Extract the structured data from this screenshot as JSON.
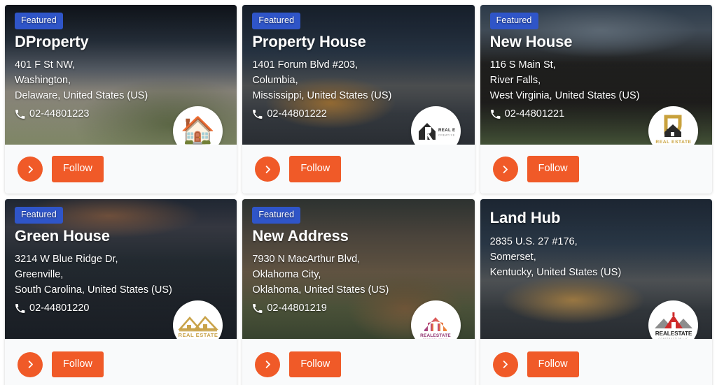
{
  "page": {
    "layout": "grid-3-columns",
    "accent_color": "#f05a28",
    "badge_color": "#2f55c8",
    "footer_background": "#f9fafb",
    "card_background": "#ffffff"
  },
  "labels": {
    "featured": "Featured",
    "follow": "Follow",
    "go_icon": "chevron-right-icon",
    "phone_icon": "phone-icon"
  },
  "cards": [
    {
      "id": "dproperty",
      "featured": true,
      "badge": "Featured",
      "title": "DProperty",
      "address_line1": "401 F St NW,",
      "address_line2": "Washington,",
      "address_line3": "Delaware, United States (US)",
      "phone": "02-44801223",
      "follow_label": "Follow",
      "avatar_icon": "house-logo-icon",
      "avatar_style": "cartoon-house-red-roof",
      "photo_class": "ph-1"
    },
    {
      "id": "property-house",
      "featured": true,
      "badge": "Featured",
      "title": "Property House",
      "address_line1": "1401 Forum Blvd #203,",
      "address_line2": "Columbia,",
      "address_line3": "Mississippi, United States (US)",
      "phone": "02-44801222",
      "follow_label": "Follow",
      "avatar_icon": "real-estate-creative-design-logo-icon",
      "avatar_style": "black-r-house-real-estate-creative-design",
      "photo_class": "ph-2"
    },
    {
      "id": "new-house",
      "featured": true,
      "badge": "Featured",
      "title": "New House",
      "address_line1": "116 S Main St,",
      "address_line2": "River Falls,",
      "address_line3": "West Virginia, United States (US)",
      "phone": "02-44801221",
      "follow_label": "Follow",
      "avatar_icon": "real-estate-tagline-logo-icon",
      "avatar_style": "gold-r-real-estate-tagline",
      "photo_class": "ph-3"
    },
    {
      "id": "green-house",
      "featured": true,
      "badge": "Featured",
      "title": "Green House",
      "address_line1": "3214 W Blue Ridge Dr,",
      "address_line2": "Greenville,",
      "address_line3": "South Carolina, United States (US)",
      "phone": "02-44801220",
      "follow_label": "Follow",
      "avatar_icon": "real-estate-slogan-logo-icon",
      "avatar_style": "gold-rooftops-real-estate-slogan",
      "photo_class": "ph-4"
    },
    {
      "id": "new-address",
      "featured": true,
      "badge": "Featured",
      "title": "New Address",
      "address_line1": "7930 N MacArthur Blvd,",
      "address_line2": "Oklahoma City,",
      "address_line3": "Oklahoma, United States (US)",
      "phone": "02-44801219",
      "follow_label": "Follow",
      "avatar_icon": "realestate-gradient-house-logo-icon",
      "avatar_style": "pink-orange-gradient-house-realestate",
      "photo_class": "ph-5"
    },
    {
      "id": "land-hub",
      "featured": false,
      "badge": "",
      "title": "Land Hub",
      "address_line1": "2835 U.S. 27 #176,",
      "address_line2": "Somerset,",
      "address_line3": "Kentucky, United States (US)",
      "phone": "",
      "follow_label": "Follow",
      "avatar_icon": "real-estate-construction-logo-icon",
      "avatar_style": "red-gray-rooftops-real-estate-construction-llc",
      "photo_class": "ph-6"
    }
  ]
}
